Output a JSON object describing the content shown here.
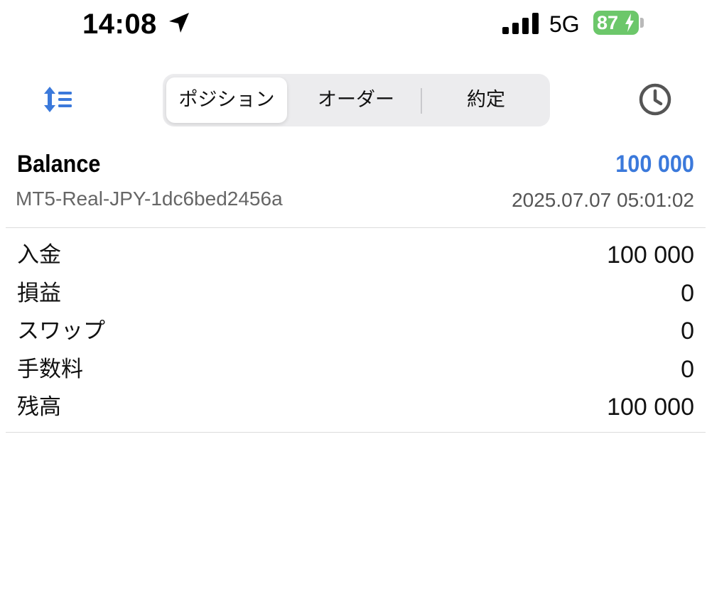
{
  "status_bar": {
    "time": "14:08",
    "network": "5G",
    "battery_percent": "87",
    "battery_color": "#6cc76a"
  },
  "toolbar": {
    "sort_icon": "sort-list-icon",
    "history_icon": "clock-icon",
    "accent_color": "#3b79db",
    "tabs": [
      {
        "label": "ポジション",
        "selected": true
      },
      {
        "label": "オーダー",
        "selected": false
      },
      {
        "label": "約定",
        "selected": false
      }
    ]
  },
  "summary": {
    "title": "Balance",
    "value": "100 000",
    "value_color": "#3b79db",
    "account": "MT5-Real-JPY-1dc6bed2456a",
    "timestamp": "2025.07.07 05:01:02"
  },
  "details": [
    {
      "label": "入金",
      "value": "100 000"
    },
    {
      "label": "損益",
      "value": "0"
    },
    {
      "label": "スワップ",
      "value": "0"
    },
    {
      "label": "手数料",
      "value": "0"
    },
    {
      "label": "残高",
      "value": "100 000"
    }
  ]
}
